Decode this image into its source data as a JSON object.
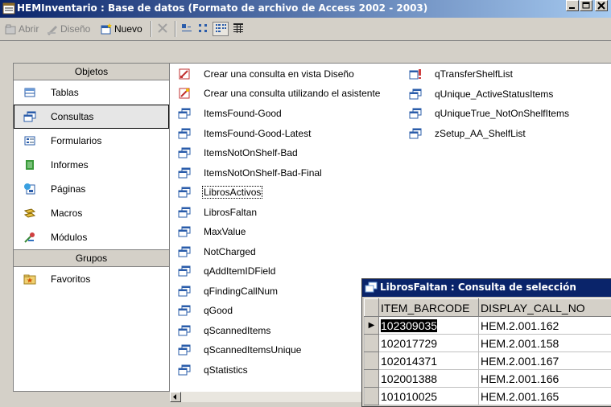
{
  "window": {
    "title": "HEMInventario : Base de datos (Formato de archivo de Access 2002 - 2003)"
  },
  "toolbar": {
    "open_label": "Abrir",
    "design_label": "Diseño",
    "new_label": "Nuevo"
  },
  "sidebar": {
    "objects_header": "Objetos",
    "items": [
      {
        "label": "Tablas",
        "icon": "table-icon"
      },
      {
        "label": "Consultas",
        "icon": "query-icon"
      },
      {
        "label": "Formularios",
        "icon": "form-icon"
      },
      {
        "label": "Informes",
        "icon": "report-icon"
      },
      {
        "label": "Páginas",
        "icon": "page-icon"
      },
      {
        "label": "Macros",
        "icon": "macro-icon"
      },
      {
        "label": "Módulos",
        "icon": "module-icon"
      }
    ],
    "groups_header": "Grupos",
    "groups": [
      {
        "label": "Favoritos",
        "icon": "folder-icon"
      }
    ]
  },
  "objects_list": {
    "column1": [
      "Crear una consulta en vista Diseño",
      "Crear una consulta utilizando el asistente",
      "ItemsFound-Good",
      "ItemsFound-Good-Latest",
      "ItemsNotOnShelf-Bad",
      "ItemsNotOnShelf-Bad-Final",
      "LibrosActivos",
      "LibrosFaltan",
      "MaxValue",
      "NotCharged",
      "qAddItemIDField",
      "qFindingCallNum",
      "qGood",
      "qScannedItems",
      "qScannedItemsUnique",
      "qStatistics"
    ],
    "column2": [
      "qTransferShelfList",
      "qUnique_ActiveStatusItems",
      "qUniqueTrue_NotOnShelfItems",
      "zSetup_AA_ShelfList"
    ]
  },
  "query_window": {
    "title": "LibrosFaltan : Consulta de selección",
    "columns": [
      "ITEM_BARCODE",
      "DISPLAY_CALL_NO"
    ],
    "rows": [
      [
        "102309035",
        "HEM.2.001.162"
      ],
      [
        "102017729",
        "HEM.2.001.158"
      ],
      [
        "102014371",
        "HEM.2.001.167"
      ],
      [
        "102001388",
        "HEM.2.001.166"
      ],
      [
        "101010025",
        "HEM.2.001.165"
      ]
    ]
  },
  "colors": {
    "title_active": "#0a246a",
    "face": "#d4d0c8"
  }
}
